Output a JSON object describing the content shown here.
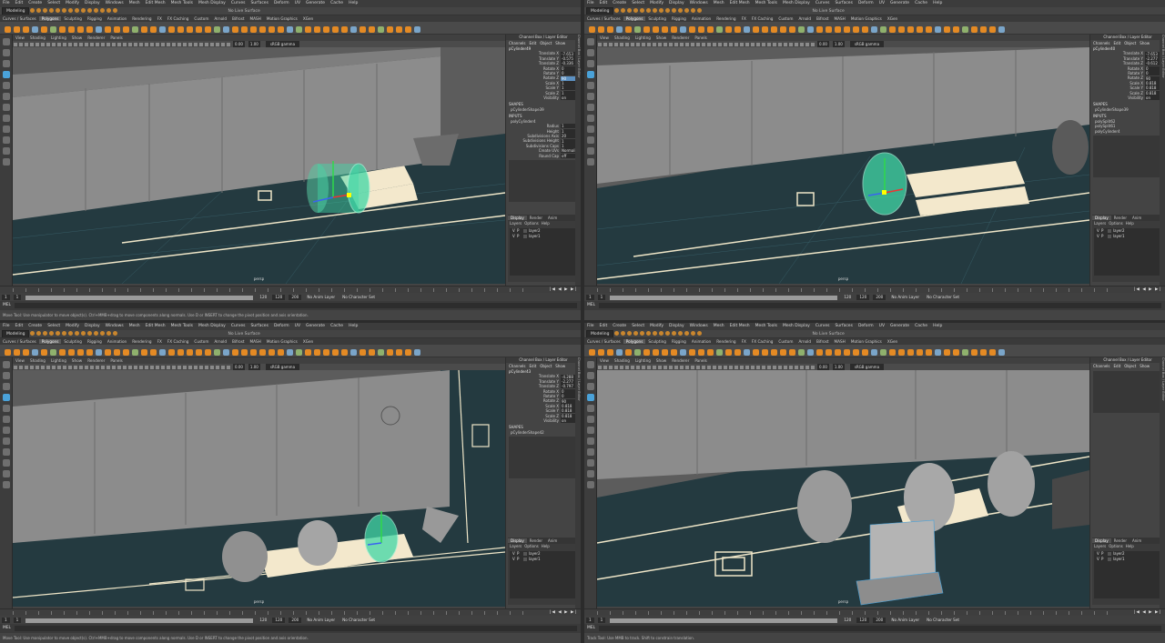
{
  "app": {
    "menus": [
      "File",
      "Edit",
      "Create",
      "Select",
      "Modify",
      "Display",
      "Windows",
      "Mesh",
      "Edit Mesh",
      "Mesh Tools",
      "Mesh Display",
      "Curves",
      "Surfaces",
      "Deform",
      "UV",
      "Generate",
      "Cache",
      "Help"
    ],
    "mode": "Modeling",
    "live_surface": "No Live Surface",
    "shelf_tabs": [
      "Curves / Surfaces",
      "Polygons",
      "Sculpting",
      "Rigging",
      "Animation",
      "Rendering",
      "FX",
      "FX Caching",
      "Custom",
      "Arnold",
      "Bifrost",
      "MASH",
      "Motion Graphics",
      "XGen"
    ],
    "active_shelf": "Polygons",
    "panel_menus": [
      "View",
      "Shading",
      "Lighting",
      "Show",
      "Renderer",
      "Panels"
    ],
    "view_values": {
      "near": "0.00",
      "far": "1.00"
    },
    "color_space": "sRGB gamma",
    "camera": "persp",
    "channel_box": {
      "title": "Channel Box / Layer Editor",
      "menus": [
        "Channels",
        "Edit",
        "Object",
        "Show"
      ],
      "shapes_label": "SHAPES",
      "inputs_label": "INPUTS"
    },
    "attr_names": [
      "Translate X",
      "Translate Y",
      "Translate Z",
      "Rotate X",
      "Rotate Y",
      "Rotate Z",
      "Scale X",
      "Scale Y",
      "Scale Z",
      "Visibility"
    ],
    "history_attrs": [
      "Radius",
      "Height",
      "Subdivisions Axis",
      "Subdivisions Height",
      "Subdivisions Caps",
      "Create UVs",
      "Round Cap"
    ],
    "layer_tabs": [
      "Display",
      "Render",
      "Anim"
    ],
    "layer_menus": [
      "Layers",
      "Options",
      "Help"
    ],
    "layers": [
      {
        "name": "layer2",
        "v": "V",
        "p": "P"
      },
      {
        "name": "layer1",
        "v": "V",
        "p": "P"
      }
    ],
    "timeline": {
      "start": "1",
      "end": "1",
      "range_start": "1",
      "range_bar_label": "120",
      "play_end": "120",
      "anim_end": "200"
    },
    "anim_layer": "No Anim Layer",
    "character_set": "No Character Set",
    "mel_label": "MEL",
    "side_tab": "Channel Box / Layer Editor"
  },
  "panes": [
    {
      "object": "pCylinder49",
      "values": [
        "-7.653",
        "-0.575",
        "-0.336",
        "0",
        "0",
        "90",
        "1",
        "1",
        "1",
        "on"
      ],
      "highlight": 5,
      "shape": "pCylinderShape39",
      "inputs": [
        "polyCylinder4"
      ],
      "history_values": [
        "1",
        "1",
        "20",
        "1",
        "1",
        "Normaliz...",
        "off"
      ],
      "help": "Move Tool: Use manipulator to move object(s). Ctrl+MMB+drag to move components along normals. Use D or INSERT to change the pivot position and axis orientation."
    },
    {
      "object": "pCylinder40",
      "values": [
        "-7.653",
        "-2.277",
        "-0.612",
        "0",
        "0",
        "90",
        "0.818",
        "0.818",
        "0.818",
        "on"
      ],
      "highlight": -1,
      "shape": "pCylinderShape39",
      "inputs": [
        "polySplit62",
        "polySplit61",
        "polyCylinder4"
      ],
      "history_values": [],
      "help": ""
    },
    {
      "object": "pCylinder43",
      "values": [
        "-4.288",
        "-2.277",
        "-0.797",
        "0",
        "0",
        "90",
        "0.818",
        "0.818",
        "0.818",
        "on"
      ],
      "highlight": -1,
      "shape": "pCylinderShape42",
      "inputs": [],
      "history_values": [],
      "help": "Move Tool: Use manipulator to move object(s). Ctrl+MMB+drag to move components along normals. Use D or INSERT to change the pivot position and axis orientation."
    },
    {
      "object": "",
      "values": [],
      "highlight": -1,
      "shape": "",
      "inputs": [],
      "history_values": [],
      "help": "Track Tool: Use MMB to track. Shift to constrain translation."
    }
  ],
  "colors": {
    "ground": "#243a40",
    "body": "#8a8a8a",
    "selection": "#41d7a6",
    "accent": "#e48a24",
    "highlight": "#5c91c2"
  }
}
